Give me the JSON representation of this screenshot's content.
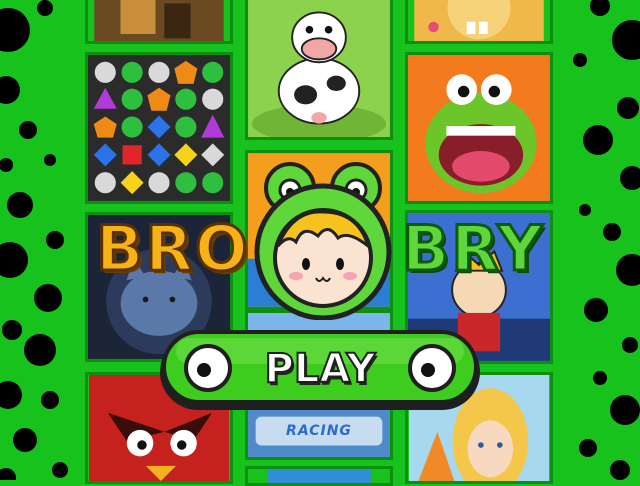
{
  "title": {
    "word_left": "BRO",
    "word_right": "BRY"
  },
  "play_button": {
    "label": "PLAY"
  },
  "thumbnails": {
    "racing_label": "RACING"
  },
  "colors": {
    "background": "#17c21d",
    "dots": "#000000",
    "play_fill": "#3ecc1f",
    "logo_left": "#f7b21a",
    "logo_right": "#5fd63a"
  }
}
